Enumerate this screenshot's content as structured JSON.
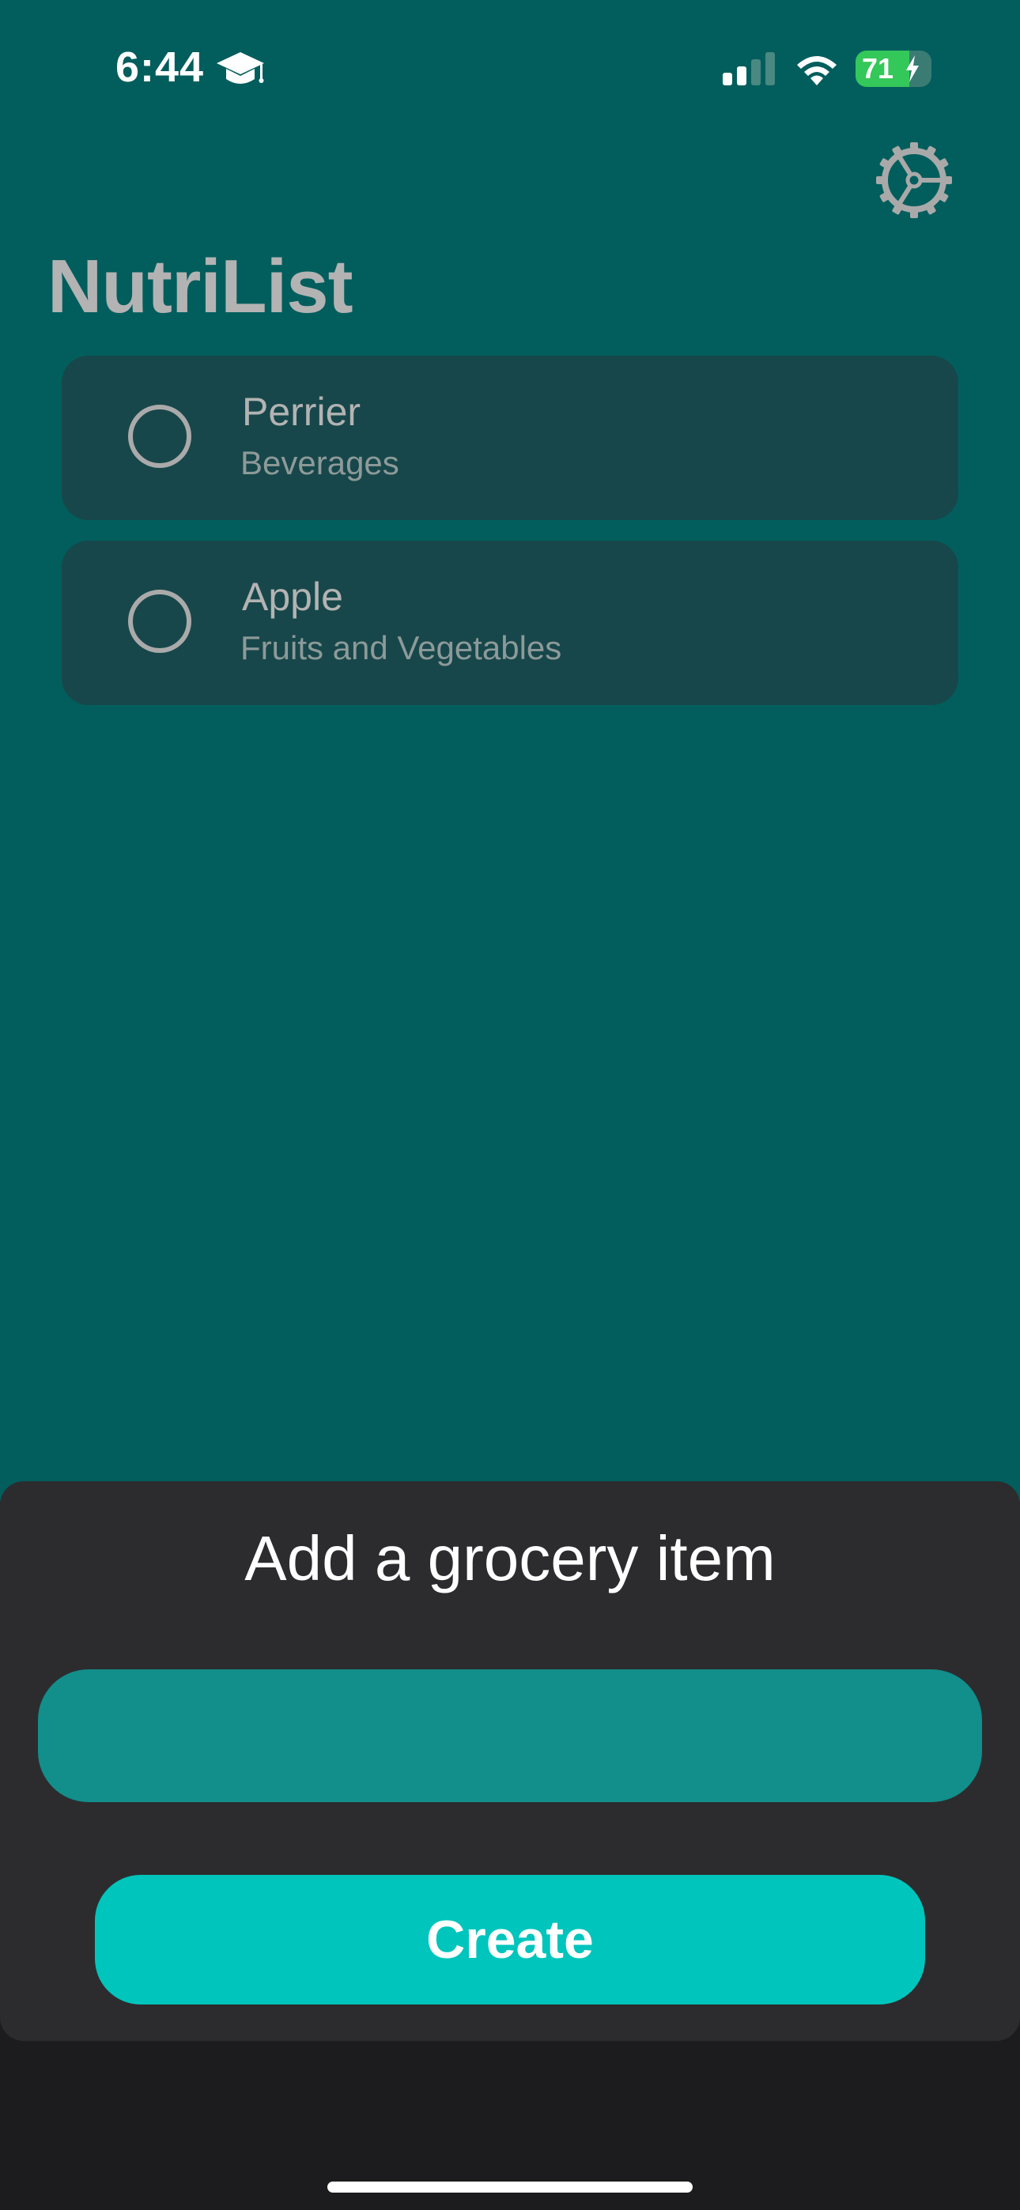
{
  "status_bar": {
    "time": "6:44",
    "focus_icon": "graduation-cap-icon",
    "signal_icon": "cellular-signal-icon",
    "wifi_icon": "wifi-icon",
    "battery_level": "71",
    "battery_fraction": 0.71,
    "battery_charging": true
  },
  "header": {
    "title": "NutriList",
    "settings_icon": "gear-icon"
  },
  "list": {
    "items": [
      {
        "name": "Perrier",
        "category": "Beverages",
        "checked": false
      },
      {
        "name": "Apple",
        "category": "Fruits and Vegetables",
        "checked": false
      }
    ]
  },
  "sheet": {
    "title": "Add a grocery item",
    "input_value": "",
    "input_placeholder": "",
    "create_label": "Create"
  },
  "colors": {
    "background": "#025e5d",
    "card": "#17474a",
    "sheet": "#2c2c2e",
    "input": "#128e8b",
    "accent": "#00c5bc"
  }
}
